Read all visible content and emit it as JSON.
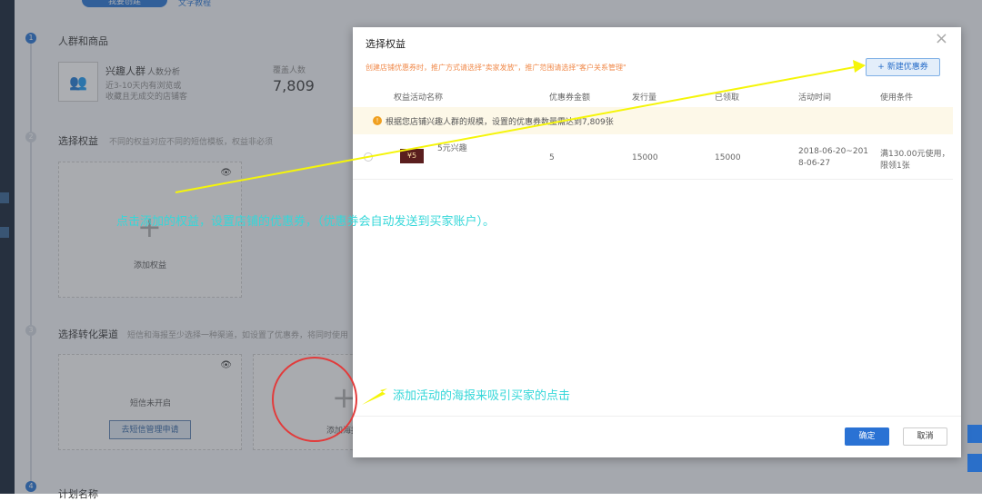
{
  "top": {
    "primary_button": "我要创建",
    "secondary_link": "文字教程"
  },
  "step1": {
    "num": "1",
    "title": "人群和商品",
    "crowd_name": "兴趣人群",
    "crowd_link": "人数分析",
    "crowd_desc1": "近3-10天内有浏览或",
    "crowd_desc2": "收藏且无成交的店铺客",
    "count_label": "覆盖人数",
    "count_value": "7,809"
  },
  "step2": {
    "num": "2",
    "title": "选择权益",
    "hint": "不同的权益对应不同的短信模板，权益非必须",
    "add_label": "添加权益"
  },
  "step3": {
    "num": "3",
    "title": "选择转化渠道",
    "hint": "短信和海报至少选择一种渠道，如设置了优惠券，将同时使用",
    "sms_status": "短信未开启",
    "sms_button": "去短信管理申请",
    "add_label": "添加海报"
  },
  "step4": {
    "num": "4",
    "title": "计划名称"
  },
  "modal": {
    "title": "选择权益",
    "notice": "创建店铺优惠券时，推广方式请选择\"卖家发放\"，推广范围请选择\"客户关系管理\"",
    "new_button": "+ 新建优惠券",
    "columns": [
      "权益活动名称",
      "优惠券金额",
      "发行量",
      "已领取",
      "活动时间",
      "使用条件"
    ],
    "tip": "根据您店铺兴趣人群的规模，设置的优惠券数量需达到7,809张",
    "rows": [
      {
        "coupon_badge": "¥5",
        "name": "5元兴趣",
        "amount": "5",
        "issued": "15000",
        "claimed": "15000",
        "time1": "2018-06-20~201",
        "time2": "8-06-27",
        "cond1": "满130.00元使用，",
        "cond2": "限领1张"
      }
    ],
    "ok": "确定",
    "cancel": "取消"
  },
  "annotations": {
    "a1": "点击添加的权益，设置店铺的优惠券，（优惠券会自动发送到买家账户）。",
    "a2": "添加活动的海报来吸引买家的点击"
  },
  "colors": {
    "accent": "#1f6fd1",
    "annotation": "#35d7d9",
    "arrow": "#f5f50a",
    "circle": "#e23b3b",
    "notice": "#f08a4b"
  }
}
